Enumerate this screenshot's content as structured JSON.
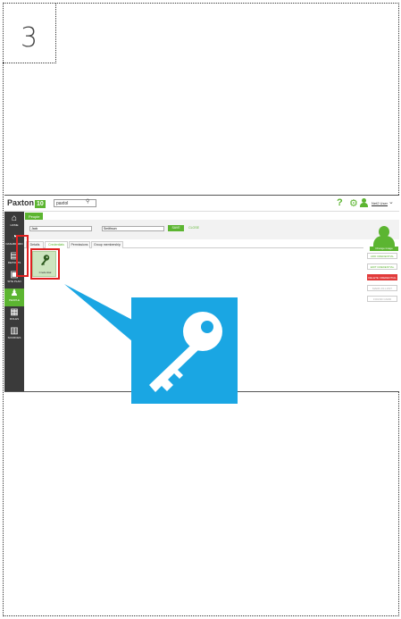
{
  "step": {
    "number": "3"
  },
  "app": {
    "logo_text": "Paxton",
    "logo_badge": "10",
    "search_value": "paxtol",
    "user_name": "Net2 User",
    "breadcrumb": "People",
    "help_icon": "?",
    "gear_icon": "⚙",
    "chevron_icon": "⌄"
  },
  "sidebar": {
    "items": [
      {
        "label": "HOME",
        "icon": "home-icon",
        "glyph": "⌂"
      },
      {
        "label": "DASHBOARD",
        "icon": "dashboard-icon",
        "glyph": "◔"
      },
      {
        "label": "REPORTS",
        "icon": "reports-icon",
        "glyph": "▤"
      },
      {
        "label": "SITE PLAN",
        "icon": "siteplan-icon",
        "glyph": "▣"
      },
      {
        "label": "PEOPLE",
        "icon": "people-icon",
        "glyph": "♟"
      },
      {
        "label": "ROLES",
        "icon": "roles-icon",
        "glyph": "▦"
      },
      {
        "label": "SOURCES",
        "icon": "sources-icon",
        "glyph": "▥"
      }
    ]
  },
  "form": {
    "first_name": "Jack",
    "last_name": "Smithson",
    "save_label": "SAVE",
    "close_label": "CLOSE",
    "change_image_label": "Change image"
  },
  "tabs": [
    {
      "label": "Details"
    },
    {
      "label": "Credentials"
    },
    {
      "label": "Permissions"
    },
    {
      "label": "Group membership"
    }
  ],
  "credential_tile": {
    "label": "Credential",
    "glyph": "🔑"
  },
  "right_buttons": [
    {
      "label": "ADD CREDENTIAL",
      "style": "normal"
    },
    {
      "label": "EDIT CREDENTIAL",
      "style": "normal"
    },
    {
      "label": "DELETE CREDENTIAL",
      "style": "red"
    },
    {
      "label": "MARK AS LOST",
      "style": "disabled"
    },
    {
      "label": "FOUND CARD",
      "style": "disabled"
    }
  ],
  "colors": {
    "accent": "#5cb531",
    "highlight": "#e02020",
    "callout": "#1aa6e3",
    "sidebar": "#3a3a3a"
  }
}
